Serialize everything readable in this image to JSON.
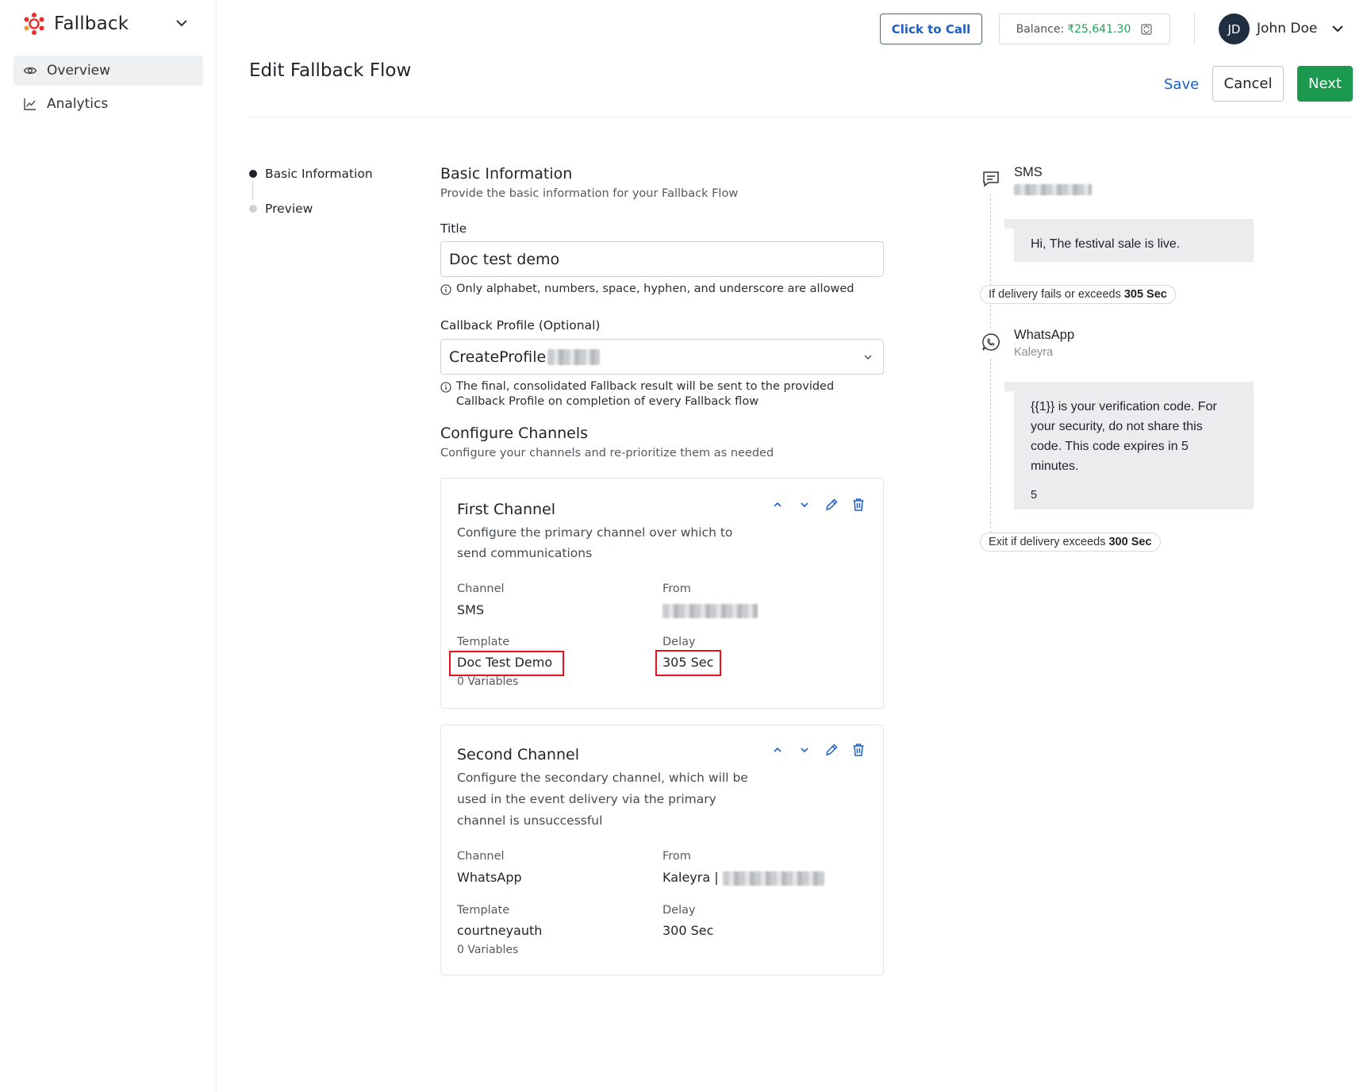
{
  "app": {
    "name": "Fallback",
    "nav": [
      {
        "label": "Overview",
        "icon": "eye-icon",
        "active": true
      },
      {
        "label": "Analytics",
        "icon": "chart-line-icon",
        "active": false
      }
    ]
  },
  "header": {
    "click_to_call": "Click to Call",
    "balance_label": "Balance:",
    "balance_amount": "₹25,641.30",
    "user_initials": "JD",
    "user_name": "John Doe"
  },
  "page": {
    "title": "Edit Fallback Flow",
    "save": "Save",
    "cancel": "Cancel",
    "next": "Next"
  },
  "steps": [
    {
      "label": "Basic Information",
      "active": true
    },
    {
      "label": "Preview",
      "active": false
    }
  ],
  "basic_info": {
    "heading": "Basic Information",
    "subheading": "Provide the basic information for your Fallback Flow",
    "title_label": "Title",
    "title_value": "Doc test demo",
    "title_hint": "Only alphabet, numbers, space, hyphen, and underscore are allowed",
    "callback_label": "Callback Profile (Optional)",
    "callback_value": "CreateProfile",
    "callback_hint_1": "The final, consolidated Fallback result will be sent to the provided",
    "callback_hint_2": "Callback Profile on completion of every Fallback flow"
  },
  "configure": {
    "heading": "Configure Channels",
    "subheading": "Configure your channels and re-prioritize them as needed"
  },
  "channels": [
    {
      "title": "First Channel",
      "desc_1": "Configure the primary channel over which to",
      "desc_2": "send communications",
      "channel_label": "Channel",
      "channel": "SMS",
      "from_label": "From",
      "from": "",
      "template_label": "Template",
      "template": "Doc Test Demo",
      "variables": "0 Variables",
      "delay_label": "Delay",
      "delay": "305 Sec"
    },
    {
      "title": "Second Channel",
      "desc_1": "Configure the secondary channel, which will be",
      "desc_2": "used in the event delivery via the primary",
      "desc_3": "channel is unsuccessful",
      "channel_label": "Channel",
      "channel": "WhatsApp",
      "from_label": "From",
      "from": "Kaleyra |",
      "template_label": "Template",
      "template": "courtneyauth",
      "variables": "0 Variables",
      "delay_label": "Delay",
      "delay": "300 Sec"
    }
  ],
  "preview": {
    "sms_title": "SMS",
    "sms_message": "Hi, The festival sale is live.",
    "fallback_pill_text": "If delivery fails or exceeds",
    "fallback_pill_value": "305 Sec",
    "wa_title": "WhatsApp",
    "wa_sub": "Kaleyra",
    "wa_message_1": "{{1}} is your verification code. For",
    "wa_message_2": "your security, do not share this",
    "wa_message_3": "code. This code expires in 5",
    "wa_message_4": "minutes.",
    "wa_footer": "5",
    "exit_pill_text": "Exit if delivery exceeds",
    "exit_pill_value": "300 Sec"
  },
  "colors": {
    "primary_blue": "#1a5fc8",
    "next_green": "#1b9a4f",
    "balance_green": "#22a35a",
    "highlight_red": "#e3141b",
    "avatar_bg": "#1f2e40"
  }
}
